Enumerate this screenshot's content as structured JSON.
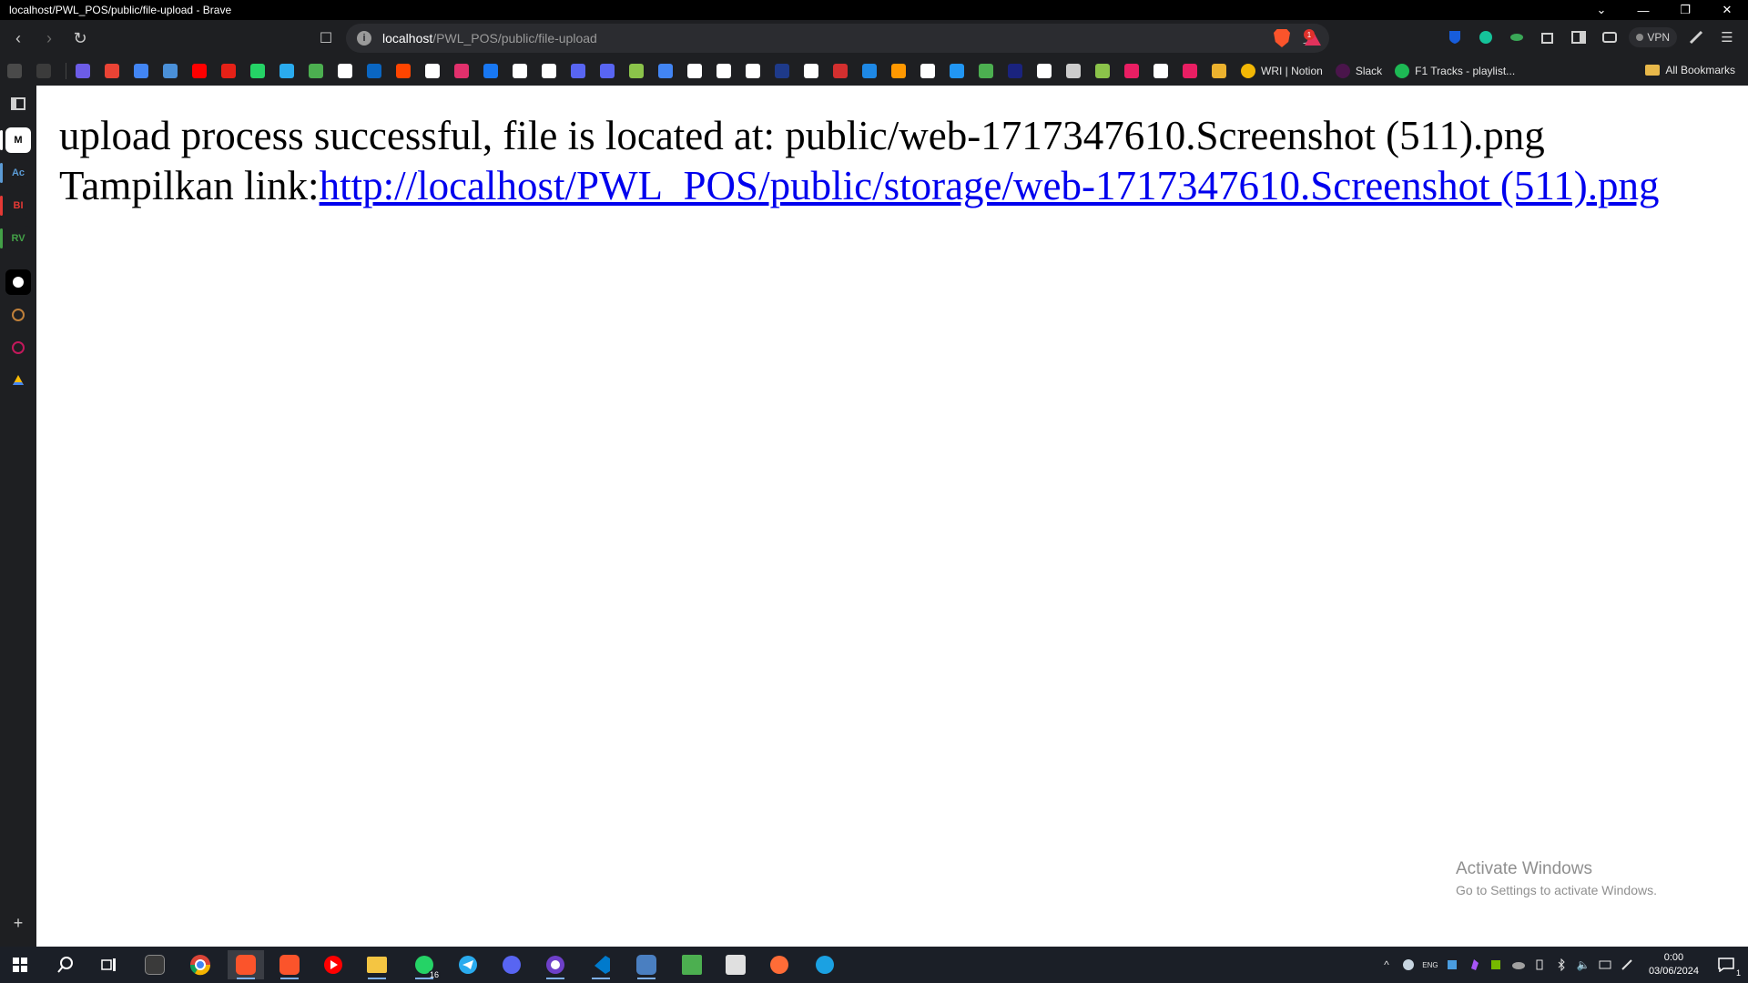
{
  "window": {
    "title": "localhost/PWL_POS/public/file-upload - Brave",
    "controls": {
      "collapse": "⌄",
      "minimize": "—",
      "restore": "❐",
      "close": "✕"
    }
  },
  "toolbar": {
    "back_icon": "‹",
    "forward_icon": "›",
    "reload_icon": "↻",
    "bookmark_icon": "☐",
    "url_host": "localhost",
    "url_path": "/PWL_POS/public/file-upload",
    "zoom_icon": "⊕",
    "share_icon": "⤴",
    "rewards_badge": "1",
    "vpn_label": "VPN"
  },
  "bookmarks": {
    "labeled": [
      {
        "label": "WRI | Notion",
        "color": "#f2b705"
      },
      {
        "label": "Slack",
        "color": "#4a154b"
      },
      {
        "label": "F1 Tracks - playlist...",
        "color": "#1db954"
      }
    ],
    "all_bookmarks": "All Bookmarks",
    "icon_colors": [
      "#4a4a4a",
      "#3b3b3b",
      "#6c5ce7",
      "#ea4335",
      "#4285f4",
      "#4a90d9",
      "#ff0000",
      "#e62117",
      "#25d366",
      "#2aabee",
      "#4caf50",
      "#ffffff",
      "#0a66c2",
      "#ff4500",
      "#ffffff",
      "#e1306c",
      "#1877f2",
      "#ffffff",
      "#ffffff",
      "#5865f2",
      "#5865f2",
      "#8bc34a",
      "#4285f4",
      "#ffffff",
      "#ffffff",
      "#ffffff",
      "#1e3a8a",
      "#ffffff",
      "#d32f2f",
      "#1e88e5",
      "#ff9800",
      "#ffffff",
      "#2196f3",
      "#4caf50",
      "#1a237e",
      "#ffffff",
      "#cccccc",
      "#8bc34a",
      "#e91e63",
      "#ffffff",
      "#e91e63",
      "#ecb22e"
    ]
  },
  "sidebar": {
    "items": [
      {
        "label": "M",
        "bg": "#ffffff",
        "fg": "#000000",
        "bar": "#ffffff"
      },
      {
        "label": "Ac",
        "bg": "#1e1f22",
        "fg": "#5b9bd5",
        "bar": "#5b9bd5"
      },
      {
        "label": "BI",
        "bg": "#1e1f22",
        "fg": "#e53935",
        "bar": "#e53935"
      },
      {
        "label": "RV",
        "bg": "#1e1f22",
        "fg": "#43a047",
        "bar": "#43a047"
      }
    ],
    "add_icon": "+"
  },
  "page": {
    "line1": "upload process successful, file is located at: public/web-1717347610.Screenshot (511).png",
    "line2_prefix": "Tampilkan link:",
    "link": "http://localhost/PWL_POS/public/storage/web-1717347610.Screenshot (511).png"
  },
  "watermark": {
    "title": "Activate Windows",
    "subtitle": "Go to Settings to activate Windows."
  },
  "taskbar": {
    "whatsapp_badge": "16",
    "tray_lang": "ENG",
    "time": "0:00",
    "date": "03/06/2024",
    "notification_count": "1"
  }
}
